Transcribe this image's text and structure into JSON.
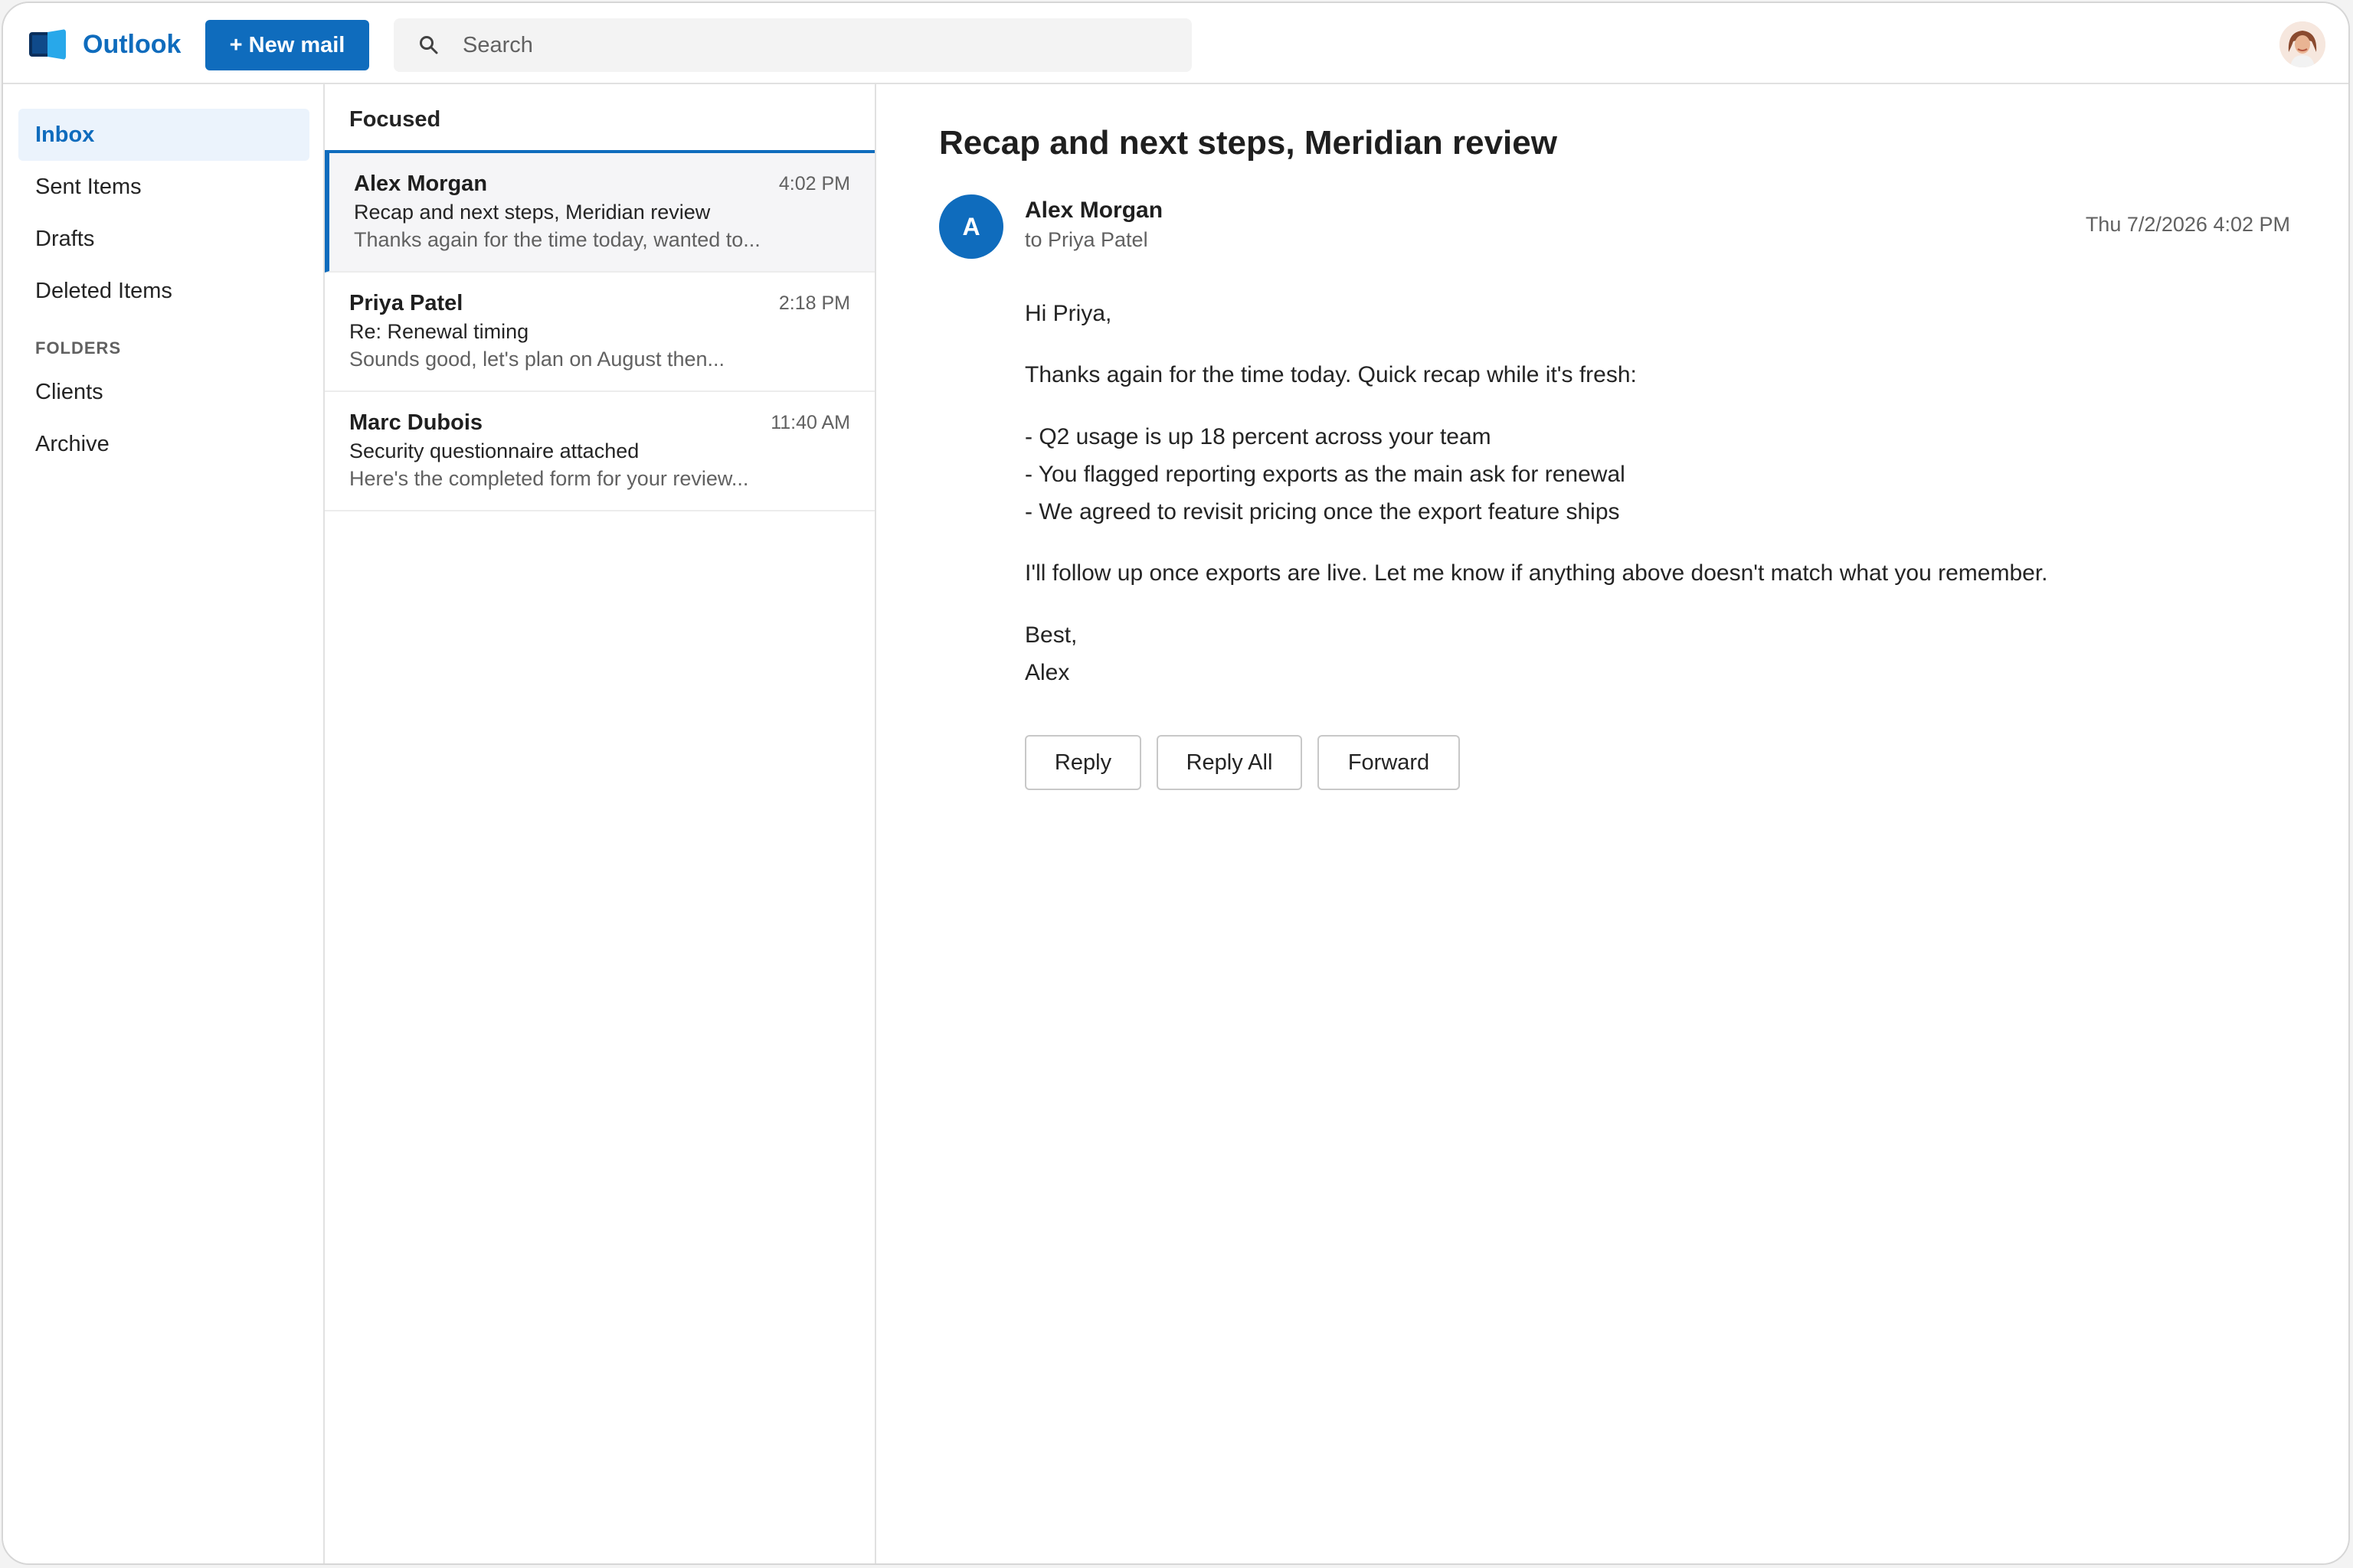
{
  "app": {
    "name": "Outlook",
    "accent": "#0f6cbd"
  },
  "header": {
    "new_mail_label": "+ New mail",
    "search_placeholder": "Search"
  },
  "nav": {
    "items": [
      {
        "label": "Inbox"
      },
      {
        "label": "Sent Items"
      },
      {
        "label": "Drafts"
      },
      {
        "label": "Deleted Items"
      }
    ],
    "folders_heading": "FOLDERS",
    "folders": [
      {
        "label": "Clients"
      },
      {
        "label": "Archive"
      }
    ]
  },
  "list": {
    "header": "Focused",
    "messages": [
      {
        "from": "Alex Morgan",
        "time": "4:02 PM",
        "subject": "Recap and next steps, Meridian review",
        "preview": "Thanks again for the time today, wanted to..."
      },
      {
        "from": "Priya Patel",
        "time": "2:18 PM",
        "subject": "Re: Renewal timing",
        "preview": "Sounds good, let's plan on August then..."
      },
      {
        "from": "Marc Dubois",
        "time": "11:40 AM",
        "subject": "Security questionnaire attached",
        "preview": "Here's the completed form for your review..."
      }
    ]
  },
  "reading": {
    "subject": "Recap and next steps, Meridian review",
    "sender_initial": "A",
    "sender_name": "Alex Morgan",
    "recipient": "to Priya Patel",
    "date": "Thu 7/2/2026 4:02 PM",
    "greeting": "Hi Priya,",
    "intro": "Thanks again for the time today. Quick recap while it's fresh:",
    "bullets": [
      "- Q2 usage is up 18 percent across your team",
      "- You flagged reporting exports as the main ask for renewal",
      "- We agreed to revisit pricing once the export feature ships"
    ],
    "followup": "I'll follow up once exports are live. Let me know if anything above doesn't match what you remember.",
    "signoff": "Best,",
    "signature": "Alex",
    "actions": {
      "reply": "Reply",
      "reply_all": "Reply All",
      "forward": "Forward"
    }
  }
}
